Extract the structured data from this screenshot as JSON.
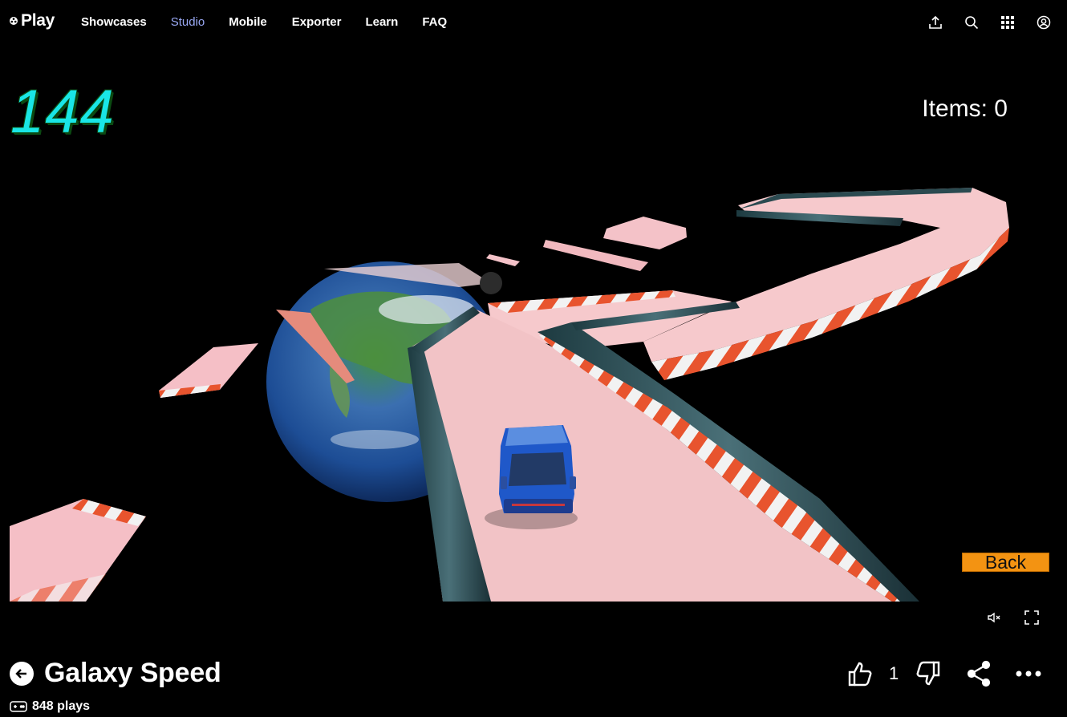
{
  "brand": {
    "name": "Play",
    "logo_icon": "roblox-style-logo-icon"
  },
  "nav": {
    "items": [
      {
        "label": "Showcases",
        "active": false
      },
      {
        "label": "Studio",
        "active": true
      },
      {
        "label": "Mobile",
        "active": false
      },
      {
        "label": "Exporter",
        "active": false
      },
      {
        "label": "Learn",
        "active": false
      },
      {
        "label": "FAQ",
        "active": false
      }
    ],
    "active_color": "#9aa9f5"
  },
  "header_icons": [
    "upload-icon",
    "search-icon",
    "apps-grid-icon",
    "account-icon"
  ],
  "game": {
    "speed": "144",
    "items_text": "Items: 0",
    "back_label": "Back",
    "speed_color": "#19e6e6",
    "back_color": "#f39312"
  },
  "controls": [
    "mute-icon",
    "fullscreen-icon"
  ],
  "details": {
    "title": "Galaxy Speed",
    "plays": "848 plays",
    "likes": "1"
  },
  "actions": [
    "thumbs-up-icon",
    "thumbs-down-icon",
    "share-icon",
    "more-icon"
  ]
}
